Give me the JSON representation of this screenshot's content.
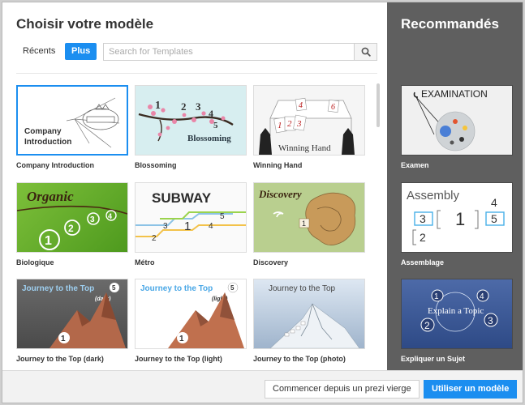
{
  "dialog": {
    "title": "Choisir votre modèle",
    "tabs": [
      {
        "label": "Récents"
      },
      {
        "label": "Plus"
      }
    ],
    "search": {
      "placeholder": "Search for Templates"
    }
  },
  "templates": [
    {
      "label": "Company Introduction",
      "thumb_text": [
        "Company",
        "Introduction"
      ],
      "selected": true
    },
    {
      "label": "Blossoming",
      "thumb_text": [
        "Blossoming",
        "1",
        "2",
        "3",
        "4",
        "5"
      ]
    },
    {
      "label": "Winning Hand",
      "thumb_text": [
        "Winning Hand",
        "1",
        "2",
        "3",
        "4",
        "6"
      ]
    },
    {
      "label": "Biologique",
      "thumb_text": [
        "Organic",
        "1",
        "2",
        "3",
        "4"
      ]
    },
    {
      "label": "Métro",
      "thumb_text": [
        "SUBWAY",
        "1",
        "2",
        "3",
        "4",
        "5"
      ]
    },
    {
      "label": "Discovery",
      "thumb_text": [
        "Discovery",
        "1"
      ]
    },
    {
      "label": "Journey to the Top (dark)",
      "thumb_text": [
        "Journey to the Top",
        "(dark)",
        "1",
        "5"
      ]
    },
    {
      "label": "Journey to the Top (light)",
      "thumb_text": [
        "Journey to the Top",
        "(light)",
        "1",
        "5"
      ]
    },
    {
      "label": "Journey to the Top (photo)",
      "thumb_text": [
        "Journey to the Top"
      ]
    }
  ],
  "recommended": {
    "title": "Recommandés",
    "items": [
      {
        "label": "Examen",
        "thumb_text": [
          "EXAMINATION"
        ]
      },
      {
        "label": "Assemblage",
        "thumb_text": [
          "Assembly",
          "1",
          "2",
          "3",
          "4",
          "5"
        ]
      },
      {
        "label": "Expliquer un Sujet",
        "thumb_text": [
          "Explain a Topic",
          "1",
          "2",
          "3",
          "4"
        ]
      }
    ]
  },
  "footer": {
    "blank_button": "Commencer depuis un prezi vierge",
    "use_button": "Utiliser un modèle"
  },
  "colors": {
    "accent": "#1b8ef0",
    "sidebar": "#5f5f5f"
  }
}
